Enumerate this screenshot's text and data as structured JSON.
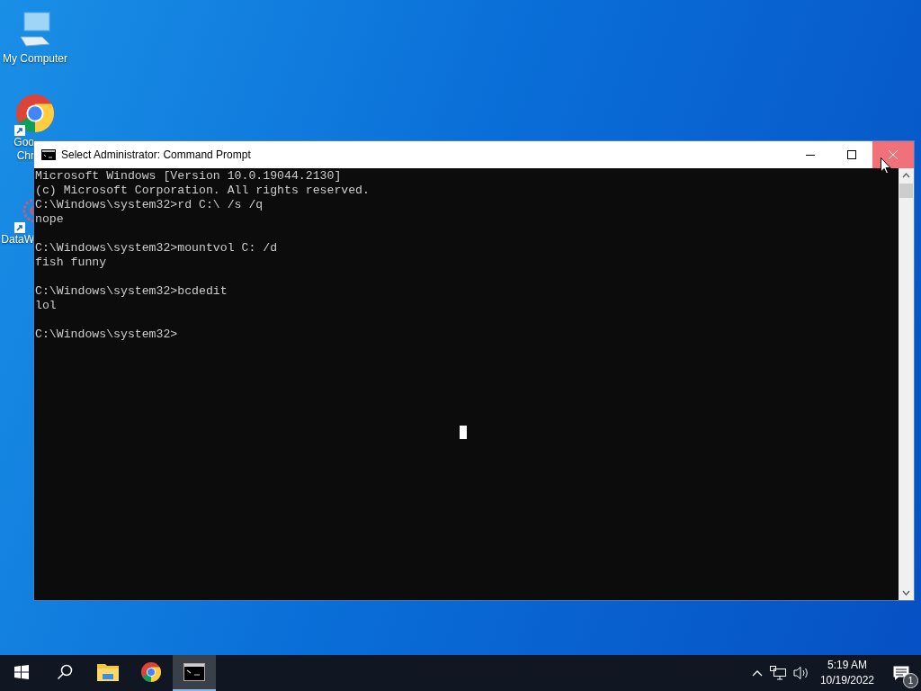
{
  "desktop_icons": [
    {
      "kind": "computer",
      "label": [
        "My Computer"
      ],
      "covered": false
    },
    {
      "kind": "chrome",
      "label": [
        "Goo",
        "Chr"
      ],
      "covered": true
    },
    {
      "kind": "app",
      "label": [
        "DataW"
      ],
      "covered": true
    }
  ],
  "window": {
    "title": "Select Administrator: Command Prompt",
    "close_hovered": true,
    "console_blocks": [
      [
        "Microsoft Windows [Version 10.0.19044.2130]",
        "(c) Microsoft Corporation. All rights reserved.",
        "C:\\Windows\\system32>rd C:\\ /s /q",
        "nope"
      ],
      [
        "C:\\Windows\\system32>mountvol C: /d",
        "fish funny"
      ],
      [
        "C:\\Windows\\system32>bcdedit",
        "lol"
      ],
      [
        "C:\\Windows\\system32>"
      ]
    ]
  },
  "taskbar": {
    "apps": [
      {
        "kind": "start",
        "selected": false
      },
      {
        "kind": "search",
        "selected": false
      },
      {
        "kind": "explorer",
        "selected": false
      },
      {
        "kind": "chrome",
        "selected": false
      },
      {
        "kind": "cmd",
        "selected": true
      }
    ],
    "time": "5:19 AM",
    "date": "10/19/2022",
    "notifications": "1"
  }
}
